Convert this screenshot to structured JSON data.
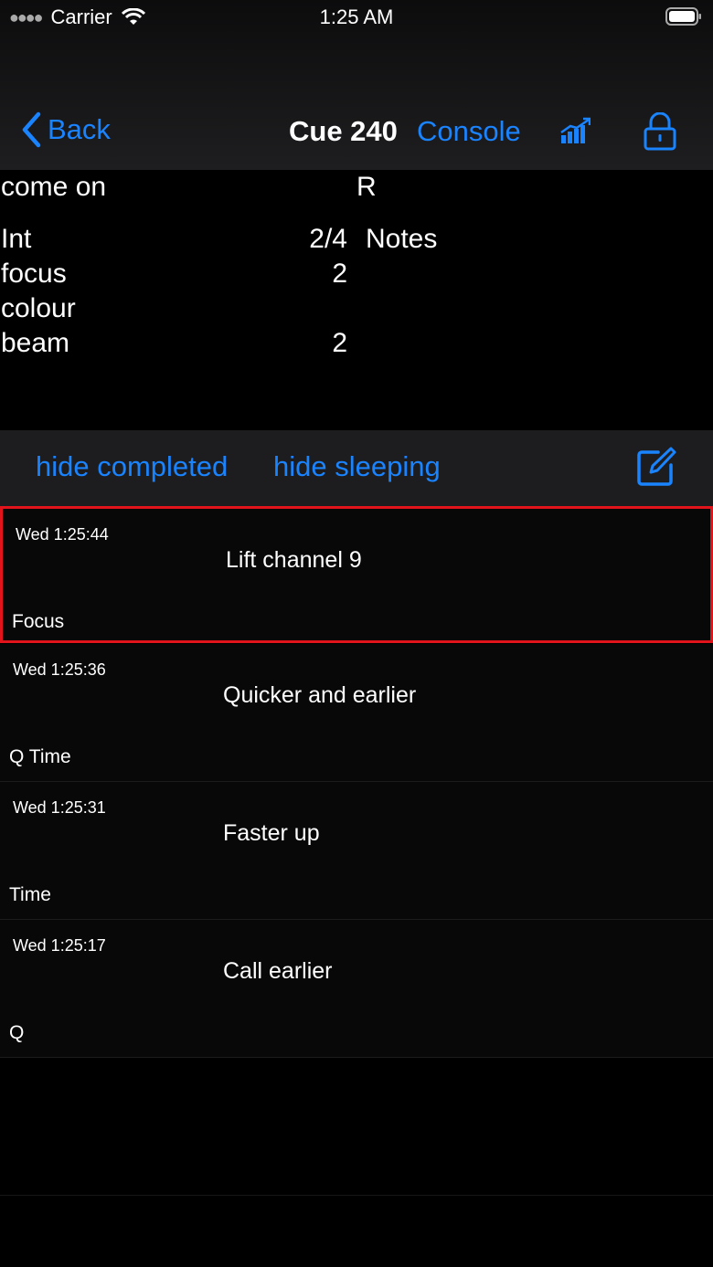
{
  "status": {
    "carrier": "Carrier",
    "time": "1:25 AM"
  },
  "nav": {
    "back_label": "Back",
    "title": "Cue 240",
    "console_label": "Console",
    "accent_color": "#1a84ff"
  },
  "cue": {
    "label": "come on",
    "tag": "R",
    "notes_header": "Notes",
    "rows": [
      {
        "name": "Int",
        "value": "2/4"
      },
      {
        "name": "focus",
        "value": "2"
      },
      {
        "name": "colour",
        "value": ""
      },
      {
        "name": "beam",
        "value": "2"
      }
    ]
  },
  "filters": {
    "hide_completed": "hide completed",
    "hide_sleeping": "hide sleeping"
  },
  "notes": [
    {
      "time": "Wed 1:25:44",
      "text": "Lift channel 9",
      "category": "Focus",
      "selected": true
    },
    {
      "time": "Wed 1:25:36",
      "text": "Quicker and earlier",
      "category": "Q Time",
      "selected": false
    },
    {
      "time": "Wed 1:25:31",
      "text": "Faster up",
      "category": "Time",
      "selected": false
    },
    {
      "time": "Wed 1:25:17",
      "text": "Call earlier",
      "category": "Q",
      "selected": false
    }
  ],
  "icons": {
    "chart": "bar-chart-icon",
    "lock": "lock-icon",
    "compose": "compose-icon",
    "back": "chevron-left-icon"
  }
}
